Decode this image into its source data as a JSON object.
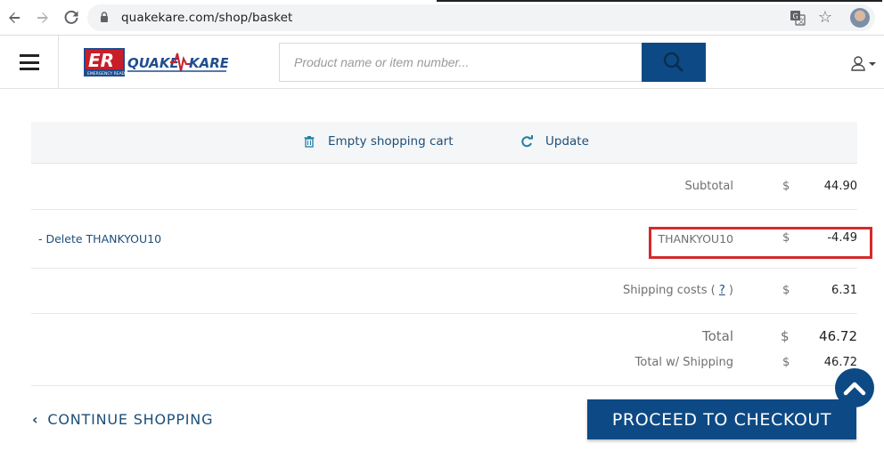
{
  "browser": {
    "url": "quakekare.com/shop/basket"
  },
  "header": {
    "logo_text": "QUAKEKARE",
    "logo_initials": "ER",
    "search_placeholder": "Product name or item number..."
  },
  "cart": {
    "empty_label": "Empty shopping cart",
    "update_label": "Update",
    "subtotal_label": "Subtotal",
    "subtotal_currency": "$",
    "subtotal_value": "44.90",
    "coupon_delete_label": "- Delete THANKYOU10",
    "coupon_code": "THANKYOU10",
    "coupon_currency": "$",
    "coupon_value": "-4.49",
    "shipping_label": "Shipping costs (",
    "shipping_help": "?",
    "shipping_label_close": ")",
    "shipping_currency": "$",
    "shipping_value": "6.31",
    "total_label": "Total",
    "total_currency": "$",
    "total_value": "46.72",
    "total_ship_label": "Total w/ Shipping",
    "total_ship_currency": "$",
    "total_ship_value": "46.72",
    "continue_label": "CONTINUE SHOPPING",
    "checkout_label": "PROCEED TO CHECKOUT"
  },
  "colors": {
    "brand_blue": "#0d4a85",
    "highlight_red": "#d42a2a"
  }
}
